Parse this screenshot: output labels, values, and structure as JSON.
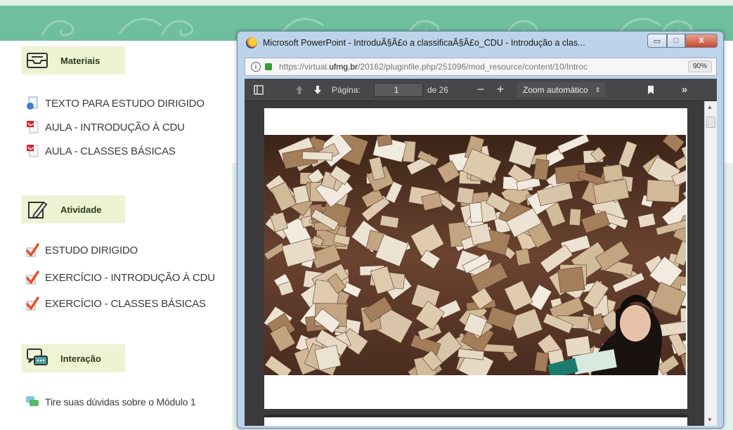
{
  "course": {
    "sections": [
      {
        "title": "Materiais",
        "icon": "inbox-tray-icon",
        "items": [
          {
            "label": "TEXTO PARA ESTUDO DIRIGIDO",
            "icon": "document-icon"
          },
          {
            "label": "AULA - INTRODUÇÃO À CDU",
            "icon": "pdf-icon"
          },
          {
            "label": "AULA - CLASSES BÁSICAS",
            "icon": "pdf-icon"
          }
        ]
      },
      {
        "title": "Atividade",
        "icon": "pen-paper-icon",
        "items": [
          {
            "label": "ESTUDO DIRIGIDO",
            "icon": "checkmark-icon"
          },
          {
            "label": "EXERCÍCIO - INTRODUÇÃO À CDU",
            "icon": "checkmark-icon"
          },
          {
            "label": "EXERCÍCIO - CLASSES BÁSICAS",
            "icon": "checkmark-icon"
          }
        ]
      },
      {
        "title": "Interação",
        "icon": "chat-bubbles-icon",
        "items": [
          {
            "label": "Tire suas dúvidas sobre o Módulo 1",
            "icon": "forum-icon"
          }
        ]
      }
    ]
  },
  "window": {
    "title": "Microsoft PowerPoint - IntroduÃ§Ã£o a classificaÃ§Ã£o_CDU - Introdução a clas...",
    "minimize_label": "▭",
    "maximize_label": "□",
    "close_label": "X",
    "address": {
      "prefix": "https://virtual.",
      "domain": "ufmg.br",
      "path": "/20162/pluginfile.php/251096/mod_resource/content/10/Introc",
      "zoom": "90%"
    },
    "pdf_toolbar": {
      "page_label": "Página:",
      "page_current": "1",
      "page_total": "de 26",
      "zoom_label": "Zoom automático"
    }
  },
  "colors": {
    "banner": "#6fbf9e",
    "section_bg": "#eef3d4",
    "checkmark": "#e4512a",
    "pdf_red": "#d9262e"
  }
}
